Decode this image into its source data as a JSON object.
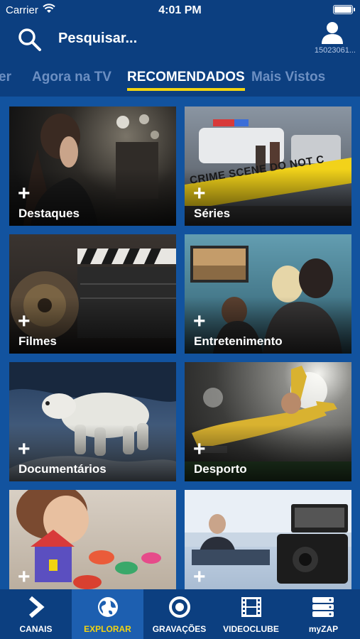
{
  "status_bar": {
    "carrier": "Carrier",
    "time": "4:01 PM"
  },
  "header": {
    "search_label": "Pesquisar...",
    "user_id": "15023061..."
  },
  "tabs": [
    {
      "label": "er"
    },
    {
      "label": "Agora na TV"
    },
    {
      "label": "RECOMENDADOS",
      "active": true
    },
    {
      "label": "Mais Vistos"
    }
  ],
  "tiles": [
    {
      "label": "Destaques",
      "plus": "+"
    },
    {
      "label": "Séries",
      "plus": "+",
      "tape_text": "CRIME SCENE DO NOT C"
    },
    {
      "label": "Filmes",
      "plus": "+"
    },
    {
      "label": "Entretenimento",
      "plus": "+"
    },
    {
      "label": "Documentários",
      "plus": "+"
    },
    {
      "label": "Desporto",
      "plus": "+"
    },
    {
      "label": "",
      "plus": "+"
    },
    {
      "label": "",
      "plus": "+"
    }
  ],
  "bottom_nav": [
    {
      "label": "CANAIS",
      "icon": "chevron-right-icon"
    },
    {
      "label": "EXPLORAR",
      "icon": "globe-icon",
      "active": true
    },
    {
      "label": "GRAVAÇÕES",
      "icon": "record-icon"
    },
    {
      "label": "VIDEOCLUBE",
      "icon": "film-strip-icon"
    },
    {
      "label": "myZAP",
      "icon": "stack-icon"
    }
  ],
  "colors": {
    "background": "#12539f",
    "header": "#0c3f80",
    "accent": "#f2d411",
    "tab_inactive": "#6c8fc2"
  }
}
